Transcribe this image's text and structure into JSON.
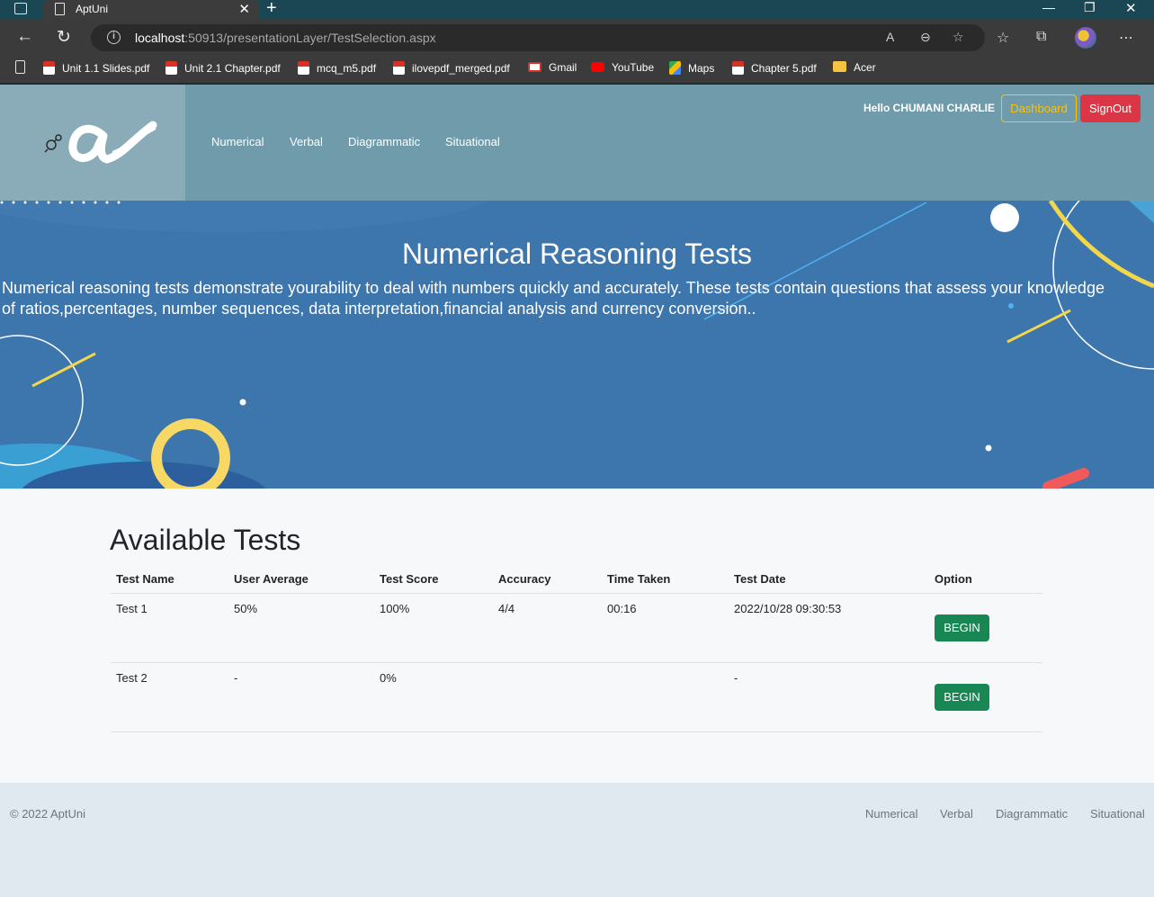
{
  "browser": {
    "tab_title": "AptUni",
    "url_host": "localhost",
    "url_rest": ":50913/presentationLayer/TestSelection.aspx",
    "bookmarks": [
      {
        "label": "Unit 1.1 Slides.pdf",
        "icon": "pdf-icon"
      },
      {
        "label": "Unit 2.1 Chapter.pdf",
        "icon": "pdf-icon"
      },
      {
        "label": "mcq_m5.pdf",
        "icon": "pdf-icon"
      },
      {
        "label": "ilovepdf_merged.pdf",
        "icon": "pdf-icon"
      },
      {
        "label": "Gmail",
        "icon": "gmail-icon"
      },
      {
        "label": "YouTube",
        "icon": "youtube-icon"
      },
      {
        "label": "Maps",
        "icon": "maps-icon"
      },
      {
        "label": "Chapter 5.pdf",
        "icon": "pdf-icon"
      },
      {
        "label": "Acer",
        "icon": "folder-icon"
      }
    ]
  },
  "header": {
    "nav": [
      "Numerical",
      "Verbal",
      "Diagrammatic",
      "Situational"
    ],
    "greeting": "Hello CHUMANI CHARLIE",
    "dashboard_label": "Dashboard",
    "signout_label": "SignOut"
  },
  "hero": {
    "title": "Numerical Reasoning Tests",
    "description": "Numerical reasoning tests demonstrate yourability to deal with numbers quickly and accurately. These tests contain questions that assess your knowledge of ratios,percentages, number sequences, data interpretation,financial analysis and currency conversion.."
  },
  "tests": {
    "heading": "Available Tests",
    "columns": [
      "Test Name",
      "User Average",
      "Test Score",
      "Accuracy",
      "Time Taken",
      "Test Date",
      "Option"
    ],
    "rows": [
      {
        "name": "Test 1",
        "user_average": "50%",
        "score": "100%",
        "accuracy": "4/4",
        "time_taken": "00:16",
        "date": "2022/10/28 09:30:53",
        "action": "BEGIN"
      },
      {
        "name": "Test 2",
        "user_average": "-",
        "score": "0%",
        "accuracy": "",
        "time_taken": "",
        "date": "-",
        "action": "BEGIN"
      }
    ]
  },
  "footer": {
    "copyright": "© 2022 AptUni",
    "links": [
      "Numerical",
      "Verbal",
      "Diagrammatic",
      "Situational"
    ]
  },
  "colors": {
    "header_bg": "#6f9bab",
    "hero_bg": "#3d75ad",
    "dashboard_outline": "#ffc107",
    "signout_bg": "#dc3545",
    "begin_bg": "#198754",
    "footer_bg": "#e1e9f0"
  }
}
